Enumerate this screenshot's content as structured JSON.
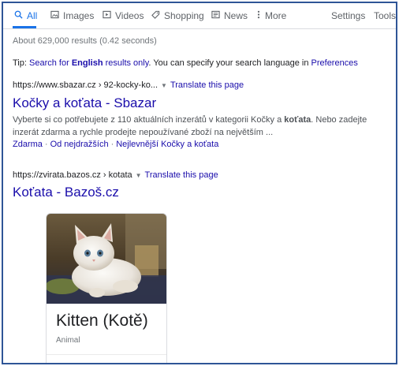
{
  "tabs": [
    {
      "label": "All",
      "icon": "search-icon",
      "active": true
    },
    {
      "label": "Images",
      "icon": "image-icon"
    },
    {
      "label": "Videos",
      "icon": "play-icon"
    },
    {
      "label": "Shopping",
      "icon": "tag-icon"
    },
    {
      "label": "News",
      "icon": "news-icon"
    },
    {
      "label": "More",
      "icon": "more-vert-icon"
    },
    {
      "label": "Settings"
    },
    {
      "label": "Tools"
    }
  ],
  "stats": "About 629,000 results (0.42 seconds)",
  "tip": {
    "prefix": "Tip: ",
    "search_for": "Search for ",
    "language": "English",
    "results_only": " results only",
    "middle": ". You can specify your search language in ",
    "preferences": "Preferences"
  },
  "results": [
    {
      "url": "https://www.sbazar.cz › 92-kocky-ko...",
      "translate": "Translate this page",
      "title": "Kočky a koťata - Sbazar",
      "snippet_a": "Vyberte si co potřebujete z 110 aktuálních inzerátů v kategorii Kočky a ",
      "snippet_bold": "koťata",
      "snippet_b": ". Nebo zadejte inzerát zdarma a rychle prodejte nepoužívané zboží na největším ...",
      "sitelinks": [
        "Zdarma",
        "Od nejdražších",
        "Nejlevnější Kočky a koťata"
      ]
    },
    {
      "url": "https://zvirata.bazos.cz › kotata",
      "translate": "Translate this page",
      "title": "Koťata - Bazoš.cz"
    }
  ],
  "card": {
    "title": "Kitten (Kotě)",
    "subtitle": "Animal"
  },
  "colors": {
    "link": "#1a0dab",
    "accent": "#1a73e8",
    "frame": "#2f5597"
  }
}
